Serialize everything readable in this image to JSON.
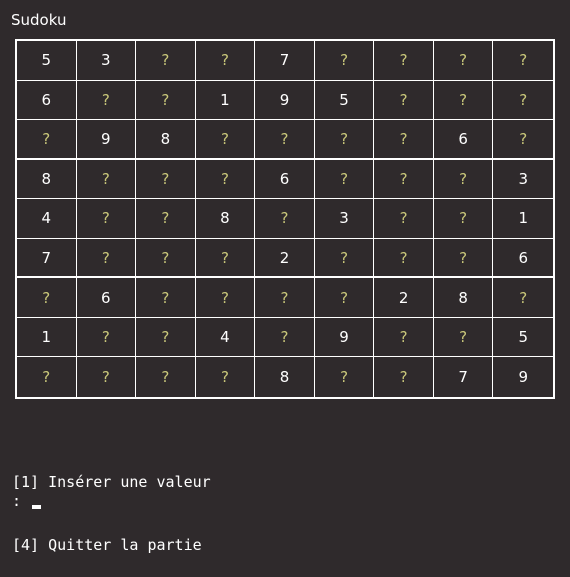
{
  "window": {
    "title": "Sudoku"
  },
  "board": {
    "rows": [
      [
        "5",
        "3",
        "?",
        "?",
        "7",
        "?",
        "?",
        "?",
        "?"
      ],
      [
        "6",
        "?",
        "?",
        "1",
        "9",
        "5",
        "?",
        "?",
        "?"
      ],
      [
        "?",
        "9",
        "8",
        "?",
        "?",
        "?",
        "?",
        "6",
        "?"
      ],
      [
        "8",
        "?",
        "?",
        "?",
        "6",
        "?",
        "?",
        "?",
        "3"
      ],
      [
        "4",
        "?",
        "?",
        "8",
        "?",
        "3",
        "?",
        "?",
        "1"
      ],
      [
        "7",
        "?",
        "?",
        "?",
        "2",
        "?",
        "?",
        "?",
        "6"
      ],
      [
        "?",
        "6",
        "?",
        "?",
        "?",
        "?",
        "2",
        "8",
        "?"
      ],
      [
        "1",
        "?",
        "?",
        "4",
        "?",
        "9",
        "?",
        "?",
        "5"
      ],
      [
        "?",
        "?",
        "?",
        "?",
        "8",
        "?",
        "?",
        "7",
        "9"
      ]
    ]
  },
  "menu": {
    "options": [
      "[1] Insérer une valeur",
      "[4] Quitter la partie"
    ]
  },
  "input": {
    "prompt": ":",
    "value": ""
  },
  "colors": {
    "background": "#2f2a2c",
    "known_digit": "#ffffff",
    "unknown_placeholder": "#c9c77a",
    "grid_line": "#ffffff"
  }
}
